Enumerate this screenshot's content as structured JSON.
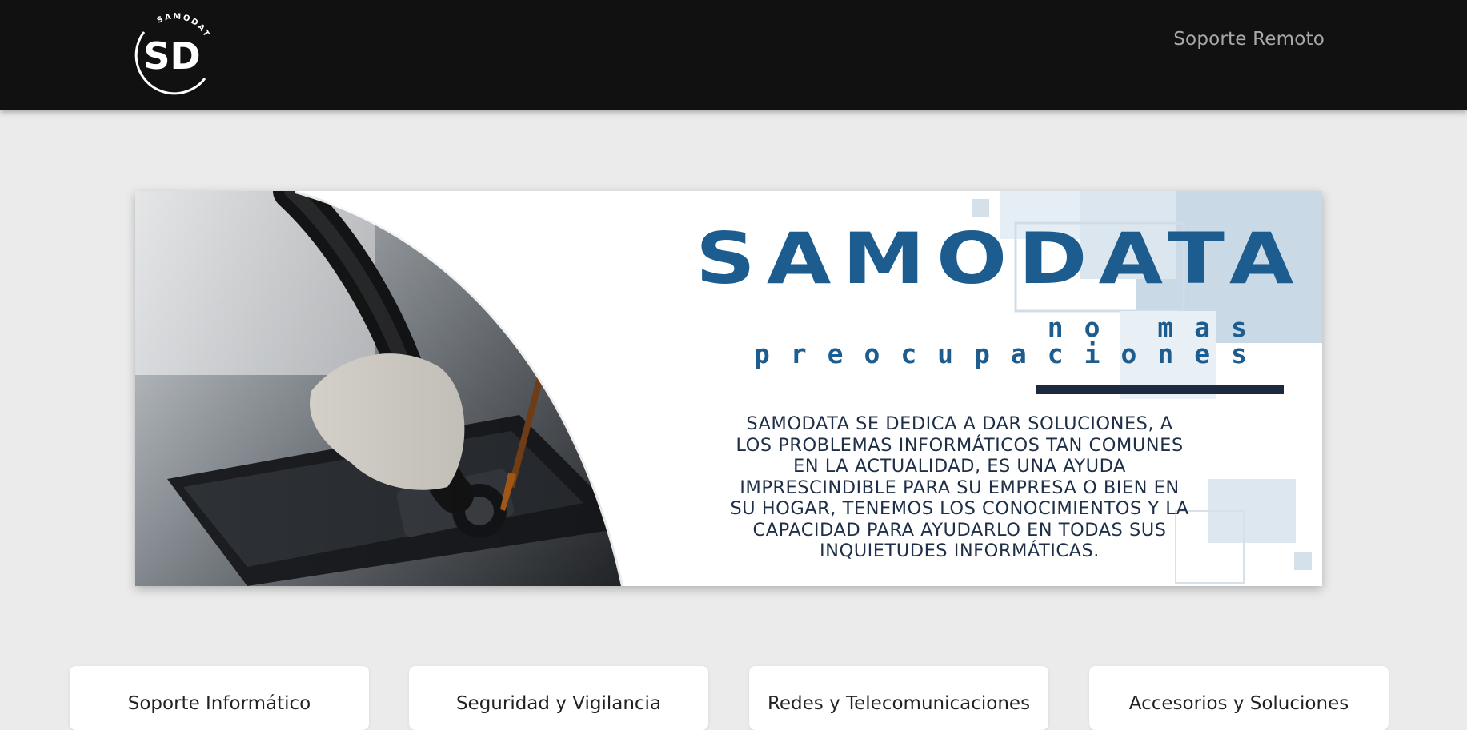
{
  "header": {
    "logo_text": "SD",
    "logo_ring_text": "SAMODATA",
    "nav_link": "Soporte Remoto"
  },
  "banner": {
    "brand": "SAMODATA",
    "tagline": "no mas preocupaciones",
    "description_lines": [
      "SAMODATA  SE DEDICA A DAR SOLUCIONES, A",
      "LOS PROBLEMAS INFORMÁTICOS TAN COMUNES",
      "EN LA ACTUALIDAD, ES UNA AYUDA",
      "IMPRESCINDIBLE PARA SU EMPRESA O BIEN EN",
      "SU HOGAR, TENEMOS LOS CONOCIMIENTOS Y LA",
      "CAPACIDAD PARA AYUDARLO EN TODAS SUS",
      "INQUIETUDES INFORMÁTICAS."
    ]
  },
  "services": [
    {
      "title": "Soporte Informático"
    },
    {
      "title": "Seguridad y Vigilancia"
    },
    {
      "title": "Redes y Telecomunicaciones"
    },
    {
      "title": "Accesorios y Soluciones"
    }
  ],
  "colors": {
    "navbar": "#111112",
    "brand_blue": "#1d5c8f",
    "page_bg": "#ebebeb",
    "nav_link": "#a9a9ab"
  }
}
